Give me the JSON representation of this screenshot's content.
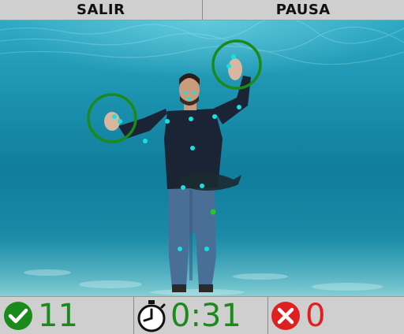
{
  "top_bar": {
    "exit_label": "SALIR",
    "pause_label": "PAUSA"
  },
  "game": {
    "targets": [
      "green-ring-target",
      "green-ring-target"
    ],
    "pose_tracking": "cyan-keypoints"
  },
  "stats": {
    "correct_icon": "check-circle-icon",
    "correct_count": "11",
    "timer_icon": "stopwatch-icon",
    "time": "0:31",
    "wrong_icon": "x-circle-icon",
    "wrong_count": "0"
  },
  "colors": {
    "bar_bg": "#cfcfcf",
    "correct": "#1a8a1a",
    "wrong": "#e02020",
    "target_ring": "#1a8a1a",
    "keypoint": "#19e0e0"
  }
}
